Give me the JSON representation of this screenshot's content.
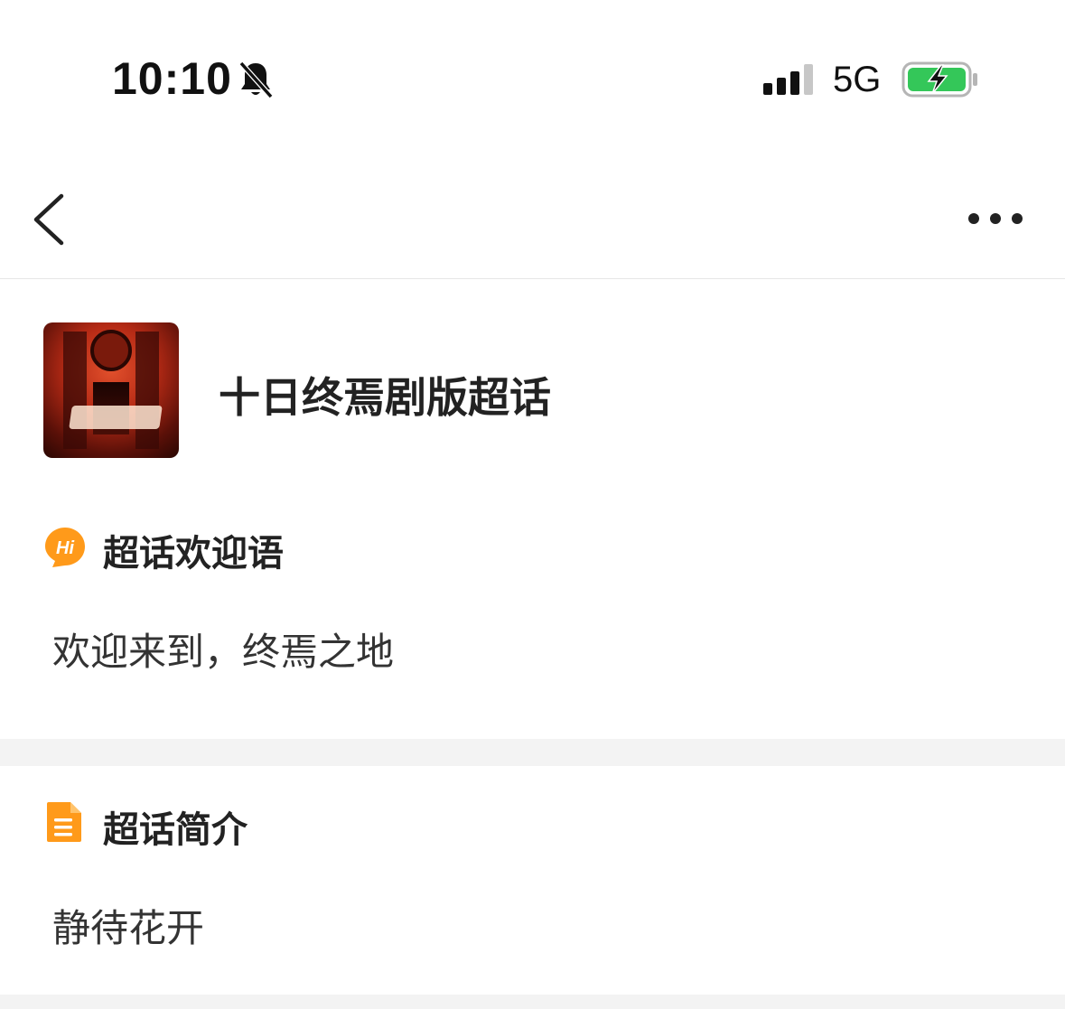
{
  "status_bar": {
    "time": "10:10",
    "network": "5G",
    "icons": [
      "bell-slash-icon",
      "signal-bars-icon",
      "battery-charging-icon"
    ],
    "battery_color": "#34c759"
  },
  "nav": {
    "back_icon": "chevron-left-icon",
    "more_icon": "more-dots-icon"
  },
  "topic": {
    "title": "十日终焉剧版超话",
    "cover_image": "topic-cover-image"
  },
  "welcome": {
    "icon": "hi-bubble-icon",
    "heading": "超话欢迎语",
    "text": "欢迎来到，终焉之地"
  },
  "intro": {
    "icon": "document-icon",
    "heading": "超话简介",
    "text": "静待花开"
  },
  "colors": {
    "accent_orange": "#ff9a1a",
    "divider_gray": "#f3f3f3"
  }
}
